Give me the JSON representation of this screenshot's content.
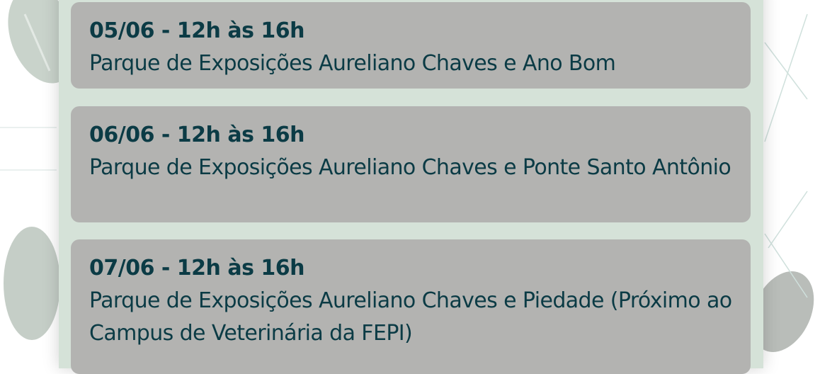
{
  "colors": {
    "panel": "#d5e2d8",
    "card": "#b3b3b1",
    "text": "#0b3b45"
  },
  "events": [
    {
      "date": "05/06 - 12h às 16h",
      "place": "Parque de Exposições Aureliano Chaves e Ano Bom"
    },
    {
      "date": "06/06 - 12h às 16h",
      "place": "Parque de Exposições Aureliano Chaves e Ponte Santo Antônio"
    },
    {
      "date": "07/06 - 12h às 16h",
      "place": "Parque de Exposições Aureliano Chaves e Piedade (Próximo ao Campus de Veterinária da FEPI)"
    }
  ]
}
